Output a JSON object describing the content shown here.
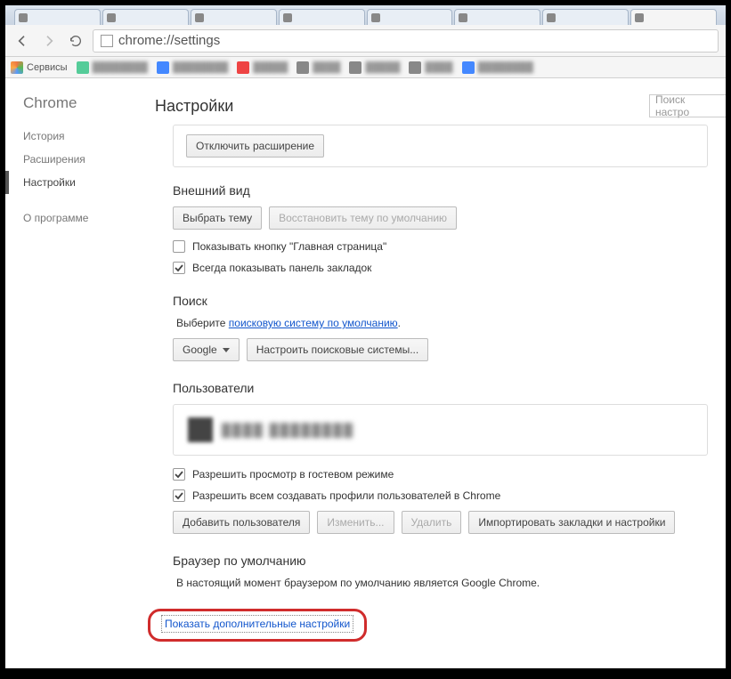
{
  "tabs": [
    {
      "label": ""
    },
    {
      "label": ""
    },
    {
      "label": ""
    },
    {
      "label": ""
    },
    {
      "label": ""
    },
    {
      "label": ""
    },
    {
      "label": ""
    },
    {
      "label": ""
    }
  ],
  "url": "chrome://settings",
  "bookmarks_label": "Сервисы",
  "sidebar": {
    "title": "Chrome",
    "items": [
      "История",
      "Расширения",
      "Настройки"
    ],
    "about": "О программе"
  },
  "page_title": "Настройки",
  "search_placeholder": "Поиск настро",
  "ext_disable_btn": "Отключить расширение",
  "appearance": {
    "title": "Внешний вид",
    "choose_theme": "Выбрать тему",
    "reset_theme": "Восстановить тему по умолчанию",
    "show_home": "Показывать кнопку \"Главная страница\"",
    "show_bookmarks": "Всегда показывать панель закладок"
  },
  "search": {
    "title": "Поиск",
    "desc": "Выберите ",
    "link": "поисковую систему по умолчанию",
    "engine": "Google",
    "manage": "Настроить поисковые системы..."
  },
  "users": {
    "title": "Пользователи",
    "guest": "Разрешить просмотр в гостевом режиме",
    "allow_create": "Разрешить всем создавать профили пользователей в Chrome",
    "add": "Добавить пользователя",
    "edit": "Изменить...",
    "delete": "Удалить",
    "import": "Импортировать закладки и настройки"
  },
  "default_browser": {
    "title": "Браузер по умолчанию",
    "desc": "В настоящий момент браузером по умолчанию является Google Chrome."
  },
  "show_more": "Показать дополнительные настройки"
}
